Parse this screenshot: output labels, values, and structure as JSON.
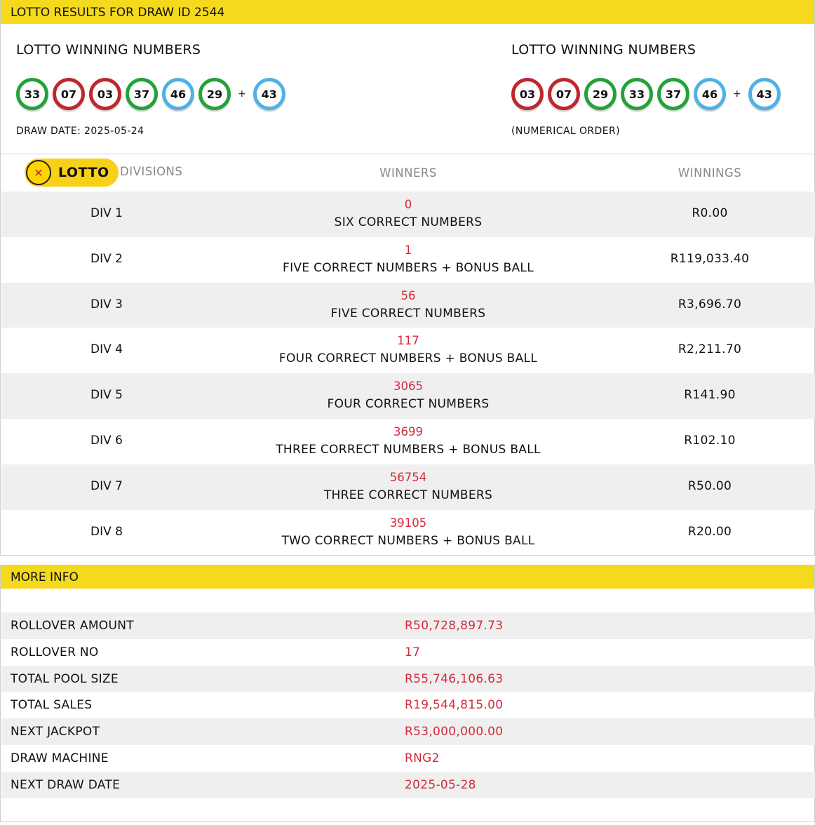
{
  "results": {
    "header": "LOTTO RESULTS FOR DRAW ID 2544",
    "left": {
      "title": "LOTTO WINNING NUMBERS",
      "balls": [
        {
          "n": "33",
          "color": "green"
        },
        {
          "n": "07",
          "color": "red"
        },
        {
          "n": "03",
          "color": "red"
        },
        {
          "n": "37",
          "color": "green"
        },
        {
          "n": "46",
          "color": "blue"
        },
        {
          "n": "29",
          "color": "green"
        }
      ],
      "plus": "+",
      "bonus": {
        "n": "43",
        "color": "blue"
      },
      "sub": "DRAW DATE: 2025-05-24"
    },
    "right": {
      "title": "LOTTO WINNING NUMBERS",
      "balls": [
        {
          "n": "03",
          "color": "red"
        },
        {
          "n": "07",
          "color": "red"
        },
        {
          "n": "29",
          "color": "green"
        },
        {
          "n": "33",
          "color": "green"
        },
        {
          "n": "37",
          "color": "green"
        },
        {
          "n": "46",
          "color": "blue"
        }
      ],
      "plus": "+",
      "bonus": {
        "n": "43",
        "color": "blue"
      },
      "sub": "(NUMERICAL ORDER)"
    },
    "logo": {
      "text": "LOTTO",
      "icon": "national-lottery-icon"
    },
    "columns": {
      "divisions": "DIVISIONS",
      "winners": "WINNERS",
      "winnings": "WINNINGS"
    },
    "divisions": [
      {
        "name": "DIV 1",
        "winners": "0",
        "desc": "SIX CORRECT NUMBERS",
        "amount": "R0.00"
      },
      {
        "name": "DIV 2",
        "winners": "1",
        "desc": "FIVE CORRECT NUMBERS + BONUS BALL",
        "amount": "R119,033.40"
      },
      {
        "name": "DIV 3",
        "winners": "56",
        "desc": "FIVE CORRECT NUMBERS",
        "amount": "R3,696.70"
      },
      {
        "name": "DIV 4",
        "winners": "117",
        "desc": "FOUR CORRECT NUMBERS + BONUS BALL",
        "amount": "R2,211.70"
      },
      {
        "name": "DIV 5",
        "winners": "3065",
        "desc": "FOUR CORRECT NUMBERS",
        "amount": "R141.90"
      },
      {
        "name": "DIV 6",
        "winners": "3699",
        "desc": "THREE CORRECT NUMBERS + BONUS BALL",
        "amount": "R102.10"
      },
      {
        "name": "DIV 7",
        "winners": "56754",
        "desc": "THREE CORRECT NUMBERS",
        "amount": "R50.00"
      },
      {
        "name": "DIV 8",
        "winners": "39105",
        "desc": "TWO CORRECT NUMBERS + BONUS BALL",
        "amount": "R20.00"
      }
    ]
  },
  "more_info": {
    "header": "MORE INFO",
    "rows": [
      {
        "label": "ROLLOVER AMOUNT",
        "value": "R50,728,897.73"
      },
      {
        "label": "ROLLOVER NO",
        "value": "17"
      },
      {
        "label": "TOTAL POOL SIZE",
        "value": "R55,746,106.63"
      },
      {
        "label": "TOTAL SALES",
        "value": "R19,544,815.00"
      },
      {
        "label": "NEXT JACKPOT",
        "value": "R53,000,000.00"
      },
      {
        "label": "DRAW MACHINE",
        "value": "RNG2"
      },
      {
        "label": "NEXT DRAW DATE",
        "value": "2025-05-28"
      }
    ]
  },
  "colors": {
    "bar": "#f4d91c",
    "accent_red": "#d42a3c",
    "ball_red": "#c0272d",
    "ball_green": "#23a23a",
    "ball_blue": "#4db2e6",
    "row_shade": "#efefef"
  }
}
